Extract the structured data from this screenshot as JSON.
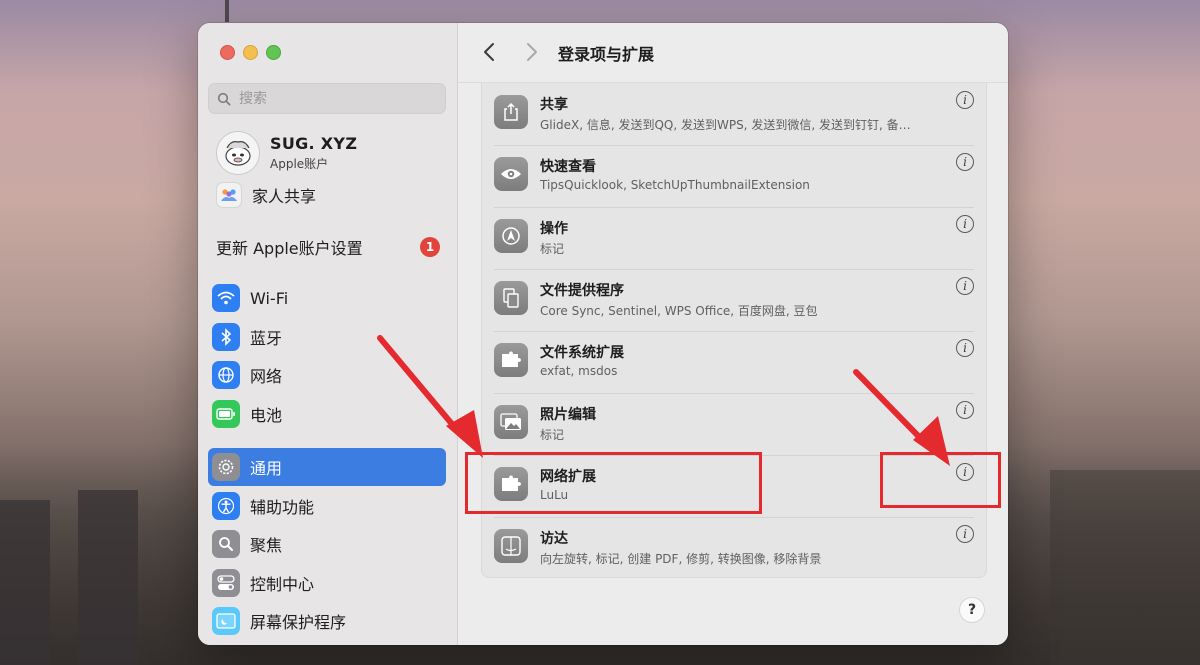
{
  "window": {
    "title": "登录项与扩展"
  },
  "sidebar": {
    "search_placeholder": "搜索",
    "account": {
      "name": "SUG. XYZ",
      "subtitle": "Apple账户"
    },
    "family_sharing": "家人共享",
    "update_prompt": {
      "label": "更新 Apple账户设置",
      "badge": "1"
    },
    "items": [
      {
        "label": "Wi-Fi",
        "icon": "wifi-icon",
        "color": "#2e7ff2"
      },
      {
        "label": "蓝牙",
        "icon": "bluetooth-icon",
        "color": "#2e7ff2"
      },
      {
        "label": "网络",
        "icon": "globe-icon",
        "color": "#2e7ff2"
      },
      {
        "label": "电池",
        "icon": "battery-icon",
        "color": "#34c759"
      },
      {
        "label": "通用",
        "icon": "gear-icon",
        "color": "#8e8e93",
        "selected": true
      },
      {
        "label": "辅助功能",
        "icon": "accessibility-icon",
        "color": "#2e7ff2"
      },
      {
        "label": "聚焦",
        "icon": "spotlight-icon",
        "color": "#8e8e93"
      },
      {
        "label": "控制中心",
        "icon": "control-center-icon",
        "color": "#8e8e93"
      },
      {
        "label": "屏幕保护程序",
        "icon": "screensaver-icon",
        "color": "#5ac8fa"
      }
    ]
  },
  "main": {
    "extensions": [
      {
        "title": "共享",
        "subtitle": "GlideX, 信息, 发送到QQ, 发送到WPS, 发送到微信, 发送到钉钉, 备…",
        "icon": "share-icon"
      },
      {
        "title": "快速查看",
        "subtitle": "TipsQuicklook, SketchUpThumbnailExtension",
        "icon": "eye-icon"
      },
      {
        "title": "操作",
        "subtitle": "标记",
        "icon": "action-icon"
      },
      {
        "title": "文件提供程序",
        "subtitle": "Core Sync, Sentinel, WPS Office, 百度网盘, 豆包",
        "icon": "file-provider-icon"
      },
      {
        "title": "文件系统扩展",
        "subtitle": "exfat, msdos",
        "icon": "puzzle-icon"
      },
      {
        "title": "照片编辑",
        "subtitle": "标记",
        "icon": "photo-icon"
      },
      {
        "title": "网络扩展",
        "subtitle": "LuLu",
        "icon": "puzzle-icon"
      },
      {
        "title": "访达",
        "subtitle": "向左旋转, 标记, 创建 PDF, 修剪, 转换图像, 移除背景",
        "icon": "finder-icon"
      }
    ],
    "info_glyph": "i",
    "help_glyph": "?"
  },
  "annotation": {
    "color": "#e52a2f"
  }
}
